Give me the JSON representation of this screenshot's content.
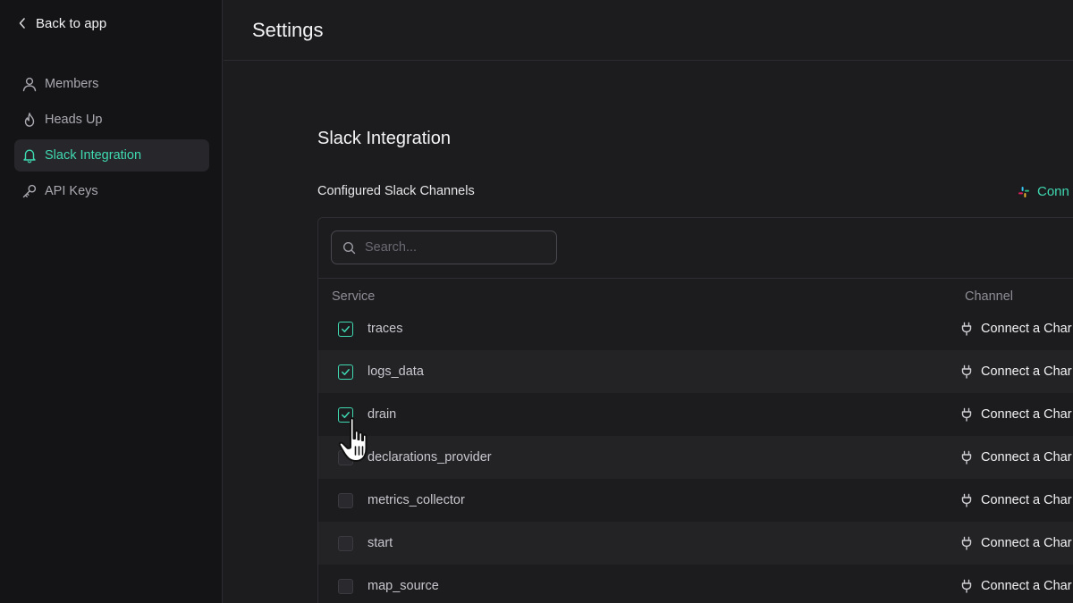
{
  "sidebar": {
    "back_label": "Back to app",
    "items": [
      {
        "label": "Members",
        "icon": "user-icon",
        "active": false
      },
      {
        "label": "Heads Up",
        "icon": "flame-icon",
        "active": false
      },
      {
        "label": "Slack Integration",
        "icon": "bell-icon",
        "active": true
      },
      {
        "label": "API Keys",
        "icon": "key-icon",
        "active": false
      }
    ]
  },
  "header": {
    "title": "Settings"
  },
  "main": {
    "section_title": "Slack Integration",
    "subtitle": "Configured Slack Channels",
    "connect_label": "Conn",
    "search": {
      "placeholder": "Search..."
    },
    "columns": {
      "service": "Service",
      "channel": "Channel"
    },
    "channel_action_label": "Connect a Char",
    "rows": [
      {
        "service": "traces",
        "checked": true
      },
      {
        "service": "logs_data",
        "checked": true
      },
      {
        "service": "drain",
        "checked": true
      },
      {
        "service": "declarations_provider",
        "checked": false
      },
      {
        "service": "metrics_collector",
        "checked": false
      },
      {
        "service": "start",
        "checked": false
      },
      {
        "service": "map_source",
        "checked": false
      }
    ]
  },
  "colors": {
    "accent": "#3fd9b2",
    "background": "#1c1c1e",
    "sidebar": "#141416"
  }
}
